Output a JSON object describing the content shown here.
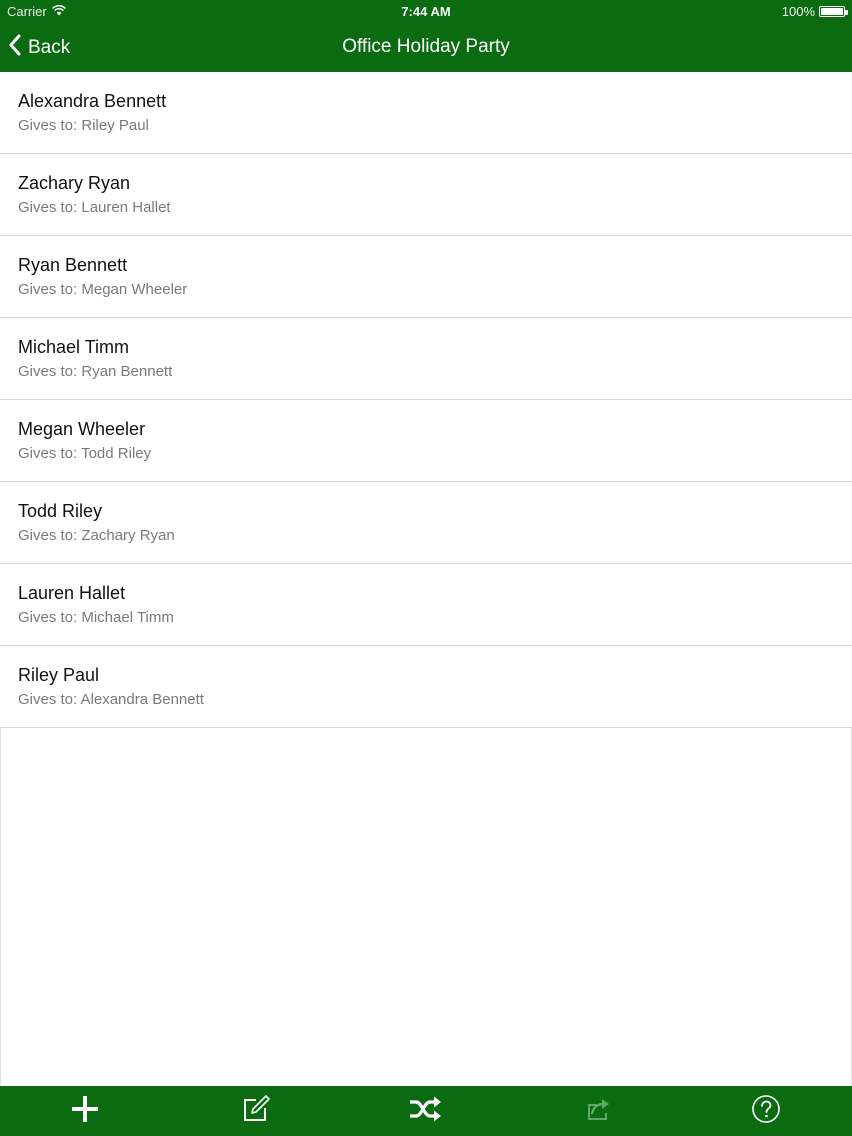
{
  "status_bar": {
    "carrier": "Carrier",
    "time": "7:44 AM",
    "battery": "100%"
  },
  "nav": {
    "back_label": "Back",
    "title": "Office Holiday Party"
  },
  "list": {
    "gives_prefix": "Gives to: ",
    "rows": [
      {
        "name": "Alexandra Bennett",
        "gives_to": "Riley Paul"
      },
      {
        "name": "Zachary Ryan",
        "gives_to": "Lauren Hallet"
      },
      {
        "name": "Ryan Bennett",
        "gives_to": "Megan Wheeler"
      },
      {
        "name": "Michael Timm",
        "gives_to": "Ryan Bennett"
      },
      {
        "name": "Megan Wheeler",
        "gives_to": "Todd Riley"
      },
      {
        "name": "Todd Riley",
        "gives_to": "Zachary Ryan"
      },
      {
        "name": "Lauren Hallet",
        "gives_to": "Michael Timm"
      },
      {
        "name": "Riley Paul",
        "gives_to": "Alexandra Bennett"
      }
    ]
  },
  "toolbar": {
    "buttons": [
      {
        "icon": "plus-icon"
      },
      {
        "icon": "edit-icon"
      },
      {
        "icon": "shuffle-icon"
      },
      {
        "icon": "share-icon",
        "disabled": true
      },
      {
        "icon": "help-icon"
      }
    ]
  },
  "colors": {
    "accent_green": "#0b6b10",
    "separator": "#d9d9d9",
    "subtitle_gray": "#7a7a7a"
  }
}
